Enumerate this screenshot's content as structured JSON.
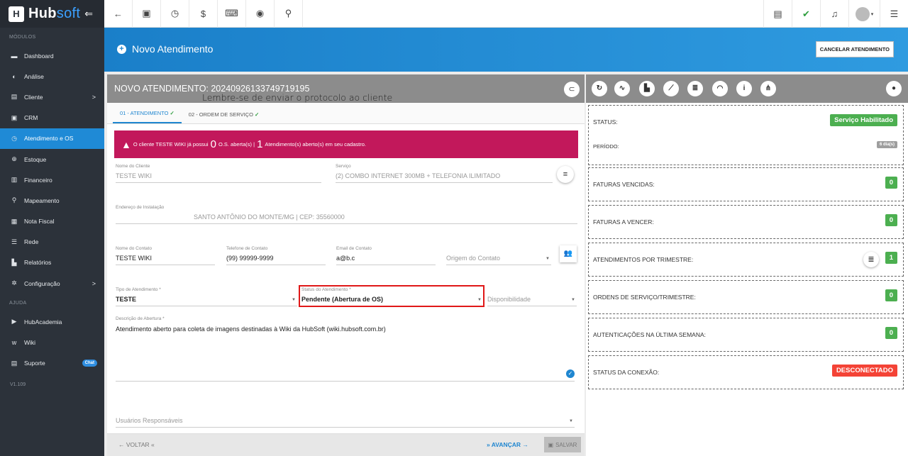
{
  "brand": {
    "name_a": "Hub",
    "name_b": "soft"
  },
  "sidebar": {
    "modules_label": "MÓDULOS",
    "items": [
      {
        "label": "Dashboard",
        "icon": "dashboard-icon"
      },
      {
        "label": "Análise",
        "icon": "chart-icon"
      },
      {
        "label": "Cliente",
        "icon": "client-icon",
        "chevron": ">"
      },
      {
        "label": "CRM",
        "icon": "crm-icon"
      },
      {
        "label": "Atendimento e OS",
        "icon": "service-icon",
        "active": true
      },
      {
        "label": "Estoque",
        "icon": "stock-icon"
      },
      {
        "label": "Financeiro",
        "icon": "finance-icon"
      },
      {
        "label": "Mapeamento",
        "icon": "map-icon"
      },
      {
        "label": "Nota Fiscal",
        "icon": "invoice-icon"
      },
      {
        "label": "Rede",
        "icon": "network-icon"
      },
      {
        "label": "Relatórios",
        "icon": "reports-icon"
      },
      {
        "label": "Configuração",
        "icon": "settings-icon",
        "chevron": ">"
      }
    ],
    "help_label": "AJUDA",
    "help_items": [
      {
        "label": "HubAcademia",
        "icon": "academy-icon"
      },
      {
        "label": "Wiki",
        "icon": "wiki-icon"
      },
      {
        "label": "Suporte",
        "icon": "support-icon",
        "badge": "Chat"
      }
    ],
    "version": "V1.109"
  },
  "header": {
    "title": "Novo Atendimento",
    "cancel_label": "CANCELAR ATENDIMENTO"
  },
  "left": {
    "title": "NOVO ATENDIMENTO: 20240926133749719195",
    "reminder": "Lembre-se de enviar o protocolo ao cliente",
    "tabs": [
      {
        "label": "01 - ATENDIMENTO"
      },
      {
        "label": "02 - ORDEM DE SERVIÇO"
      }
    ],
    "alert": {
      "part1": "O cliente TESTE WIKI já possui",
      "count1": "0",
      "part2": "O.S. aberta(s) |",
      "count2": "1",
      "part3": "Atendimento(s) aberto(s) em seu cadastro."
    },
    "fields": {
      "client_label": "Nome do Cliente",
      "client_value": "TESTE WIKI",
      "service_label": "Serviço",
      "service_value": "(2) COMBO INTERNET 300MB + TELEFONIA ILIMITADO",
      "address_label": "Endereço de Instalação",
      "address_value": "SANTO ANTÔNIO DO MONTE/MG | CEP: 35560000",
      "contact_label": "Nome do Contato",
      "contact_value": "TESTE WIKI",
      "phone_label": "Telefone de Contato",
      "phone_value": "(99) 99999-9999",
      "email_label": "Email de Contato",
      "email_value": "a@b.c",
      "origin_placeholder": "Origem do Contato",
      "type_label": "Tipo de Atendimento *",
      "type_value": "TESTE",
      "status_label": "Status do Atendimento *",
      "status_value": "Pendente (Abertura de OS)",
      "availability_placeholder": "Disponibilidade",
      "desc_label": "Descrição de Abertura *",
      "desc_value": "Atendimento aberto para coleta de imagens destinadas à Wiki da HubSoft (wiki.hubsoft.com.br)",
      "users_placeholder": "Usuários Responsáveis"
    },
    "footer": {
      "back": "VOLTAR",
      "next": "AVANÇAR",
      "save": "SALVAR"
    }
  },
  "right": {
    "status_label": "STATUS:",
    "status_value": "Serviço Habilitado",
    "period_label": "PERÍODO:",
    "period_value": "6 dia(s)",
    "cards": [
      {
        "label": "FATURAS VENCIDAS:",
        "value": "0"
      },
      {
        "label": "FATURAS A VENCER:",
        "value": "0"
      },
      {
        "label": "ATENDIMENTOS POR TRIMESTRE:",
        "value": "1"
      },
      {
        "label": "ORDENS DE SERVIÇO/TRIMESTRE:",
        "value": "0"
      },
      {
        "label": "AUTENTICAÇÕES NA ÚLTIMA SEMANA:",
        "value": "0"
      }
    ],
    "conn_label": "STATUS DA CONEXÃO:",
    "conn_value": "DESCONECTADO"
  },
  "colors": {
    "accent": "#1f86d0",
    "alert": "#c2185b",
    "success": "#4caf50",
    "danger": "#f44336"
  }
}
